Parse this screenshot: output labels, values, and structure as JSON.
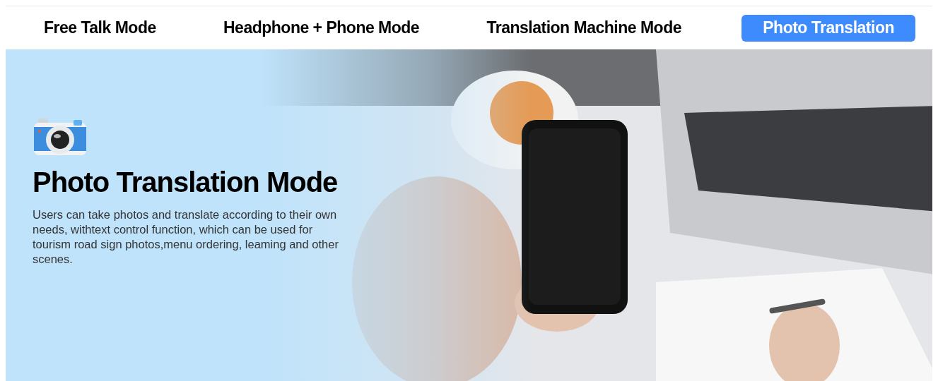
{
  "tabs": [
    {
      "label": "Free Talk Mode",
      "selected": false
    },
    {
      "label": "Headphone + Phone Mode",
      "selected": false
    },
    {
      "label": "Translation Machine Mode",
      "selected": false
    },
    {
      "label": "Photo Translation",
      "selected": true
    }
  ],
  "banner": {
    "title": "Photo Translation Mode",
    "description": "Users can take photos and translate according to their own needs, withtext control function, which can be used for tourism road sign photos,menu ordering, leaming and other scenes."
  }
}
